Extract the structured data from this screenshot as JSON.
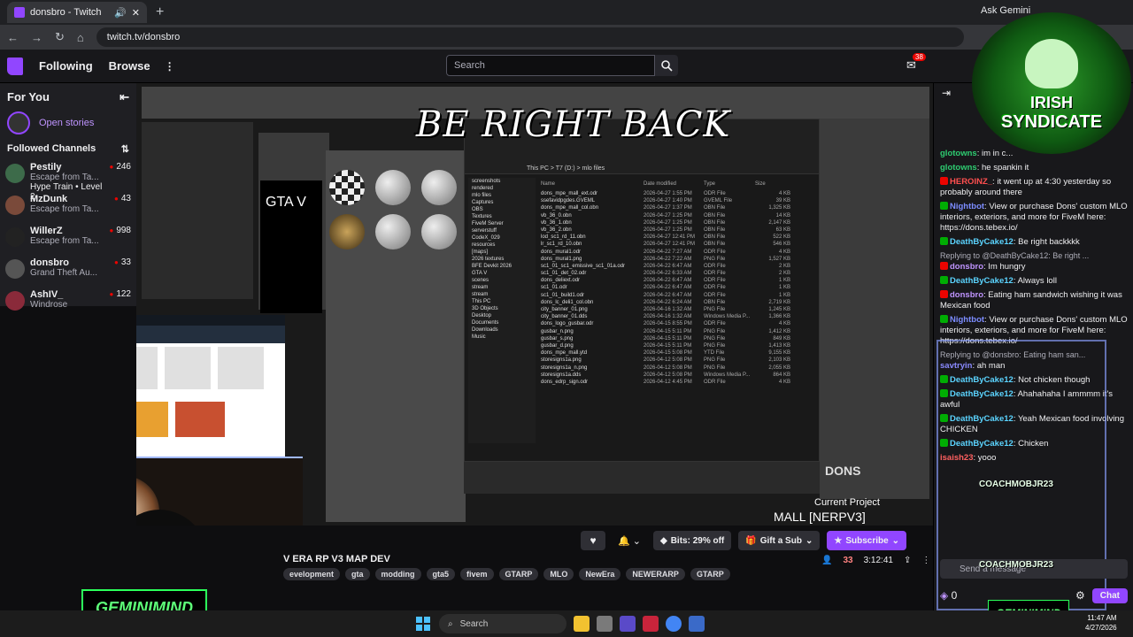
{
  "browser": {
    "tab_title": "donsbro - Twitch",
    "new_tab": "+",
    "ask_gemini": "Ask Gemini",
    "url": "twitch.tv/donsbro"
  },
  "topnav": {
    "following": "Following",
    "browse": "Browse",
    "more": "⋮",
    "search_placeholder": "Search",
    "notifications_count": "38"
  },
  "sidebar": {
    "for_you": "For You",
    "open_stories": "Open stories",
    "followed_channels": "Followed Channels",
    "channels": [
      {
        "name": "Pestily",
        "game": "Escape from Ta...",
        "viewers": "246",
        "extra": "Hype Train • Level 2",
        "color": "#3d6b4a"
      },
      {
        "name": "MzDunk",
        "game": "Escape from Ta...",
        "viewers": "43",
        "extra": "",
        "color": "#7a4a3a"
      },
      {
        "name": "WillerZ",
        "game": "Escape from Ta...",
        "viewers": "998",
        "extra": "",
        "color": "#222222"
      },
      {
        "name": "donsbro",
        "game": "Grand Theft Au...",
        "viewers": "33",
        "extra": "",
        "color": "#555555"
      },
      {
        "name": "AshIV_",
        "game": "Windrose",
        "viewers": "122",
        "extra": "",
        "color": "#8a2a3a"
      }
    ]
  },
  "stream": {
    "brb_text": "BE RIGHT BACK",
    "gta_text": "GTA V",
    "current_project_label": "Current Project",
    "current_project": "MALL [NERPV3]",
    "dons_logo": "DONS",
    "explorer_path": "This PC > T7 (D:) > mlo files",
    "explorer_columns": [
      "Name",
      "Date modified",
      "Type",
      "Size"
    ],
    "explorer_nav": [
      "screenshots",
      "rendered",
      "mlo files",
      "Captures",
      "OBS",
      "Textures",
      "FiveM Server",
      "serverstuff",
      "CodeX_029",
      "resources",
      "[maps]",
      "2026 textures",
      "BFE Devkit 2026",
      "GTA V",
      "scenes",
      "stream",
      "stream",
      "This PC",
      "3D Objects",
      "Desktop",
      "Documents",
      "Downloads",
      "Music"
    ],
    "explorer_files": [
      {
        "name": "dons_mpe_mall_ext.odr",
        "date": "2026-04-27 1:55 PM",
        "type": "ODR File",
        "size": "4 KB"
      },
      {
        "name": "ssefavidpgdes.GVEML",
        "date": "2026-04-27 1:40 PM",
        "type": "GVEML File",
        "size": "39 KB"
      },
      {
        "name": "dons_mpe_mall_col.obn",
        "date": "2026-04-27 1:37 PM",
        "type": "OBN File",
        "size": "1,325 KB"
      },
      {
        "name": "vb_36_0.obn",
        "date": "2026-04-27 1:25 PM",
        "type": "OBN File",
        "size": "14 KB"
      },
      {
        "name": "vb_36_1.obn",
        "date": "2026-04-27 1:25 PM",
        "type": "OBN File",
        "size": "2,147 KB"
      },
      {
        "name": "vb_36_2.obn",
        "date": "2026-04-27 1:25 PM",
        "type": "OBN File",
        "size": "63 KB"
      },
      {
        "name": "lod_sc1_rd_11.obn",
        "date": "2026-04-27 12:41 PM",
        "type": "OBN File",
        "size": "522 KB"
      },
      {
        "name": "lr_sc1_rd_10.obn",
        "date": "2026-04-27 12:41 PM",
        "type": "OBN File",
        "size": "546 KB"
      },
      {
        "name": "dons_mural1.odr",
        "date": "2026-04-22 7:27 AM",
        "type": "ODR File",
        "size": "4 KB"
      },
      {
        "name": "dons_mural1.png",
        "date": "2026-04-22 7:22 AM",
        "type": "PNG File",
        "size": "1,527 KB"
      },
      {
        "name": "sc1_01_sc1_emissive_sc1_01a.odr",
        "date": "2026-04-22 6:47 AM",
        "type": "ODR File",
        "size": "2 KB"
      },
      {
        "name": "sc1_01_det_02.odr",
        "date": "2026-04-22 6:33 AM",
        "type": "ODR File",
        "size": "2 KB"
      },
      {
        "name": "dons_deliext.odr",
        "date": "2026-04-22 6:47 AM",
        "type": "ODR File",
        "size": "1 KB"
      },
      {
        "name": "sc1_01.odr",
        "date": "2026-04-22 6:47 AM",
        "type": "ODR File",
        "size": "1 KB"
      },
      {
        "name": "sc1_01_build1.odr",
        "date": "2026-04-22 6:47 AM",
        "type": "ODR File",
        "size": "1 KB"
      },
      {
        "name": "dons_lc_deli1_col.obn",
        "date": "2026-04-22 6:24 AM",
        "type": "OBN File",
        "size": "2,719 KB"
      },
      {
        "name": "city_banner_01.png",
        "date": "2026-04-16 1:32 AM",
        "type": "PNG File",
        "size": "1,245 KB"
      },
      {
        "name": "city_banner_01.dds",
        "date": "2026-04-16 1:32 AM",
        "type": "Windows Media P...",
        "size": "1,366 KB"
      },
      {
        "name": "dons_logo_gusbar.odr",
        "date": "2026-04-15 8:55 PM",
        "type": "ODR File",
        "size": "4 KB"
      },
      {
        "name": "gusbar_n.png",
        "date": "2026-04-15 5:11 PM",
        "type": "PNG File",
        "size": "1,412 KB"
      },
      {
        "name": "gusbar_s.png",
        "date": "2026-04-15 5:11 PM",
        "type": "PNG File",
        "size": "849 KB"
      },
      {
        "name": "gusbar_d.png",
        "date": "2026-04-15 5:11 PM",
        "type": "PNG File",
        "size": "1,413 KB"
      },
      {
        "name": "dons_mpe_mall.ytd",
        "date": "2026-04-15 5:08 PM",
        "type": "YTD File",
        "size": "9,155 KB"
      },
      {
        "name": "storesigns1a.png",
        "date": "2026-04-12 5:08 PM",
        "type": "PNG File",
        "size": "2,103 KB"
      },
      {
        "name": "storesigns1a_n.png",
        "date": "2026-04-12 5:08 PM",
        "type": "PNG File",
        "size": "2,055 KB"
      },
      {
        "name": "storesigns1a.dds",
        "date": "2026-04-12 5:08 PM",
        "type": "Windows Media P...",
        "size": "864 KB"
      },
      {
        "name": "dons_edrp_sign.odr",
        "date": "2026-04-12 4:45 PM",
        "type": "ODR File",
        "size": "4 KB"
      }
    ]
  },
  "stream_info": {
    "title": "V ERA RP V3 MAP DEV",
    "tags": [
      "evelopment",
      "gta",
      "modding",
      "gta5",
      "fivem",
      "GTARP",
      "MLO",
      "NewEra",
      "NEWERARP",
      "GTARP"
    ],
    "bits": "Bits: 29% off",
    "gift_sub": "Gift a Sub",
    "subscribe": "Subscribe",
    "viewers": "33",
    "uptime": "3:12:41",
    "gemini_logo": "GEMINIMIND"
  },
  "chat": {
    "irish_line1": "IRISH",
    "irish_line2": "SYNDICATE",
    "messages": [
      {
        "kind": "msg",
        "user": "glotowns",
        "user_color": "#2ecc71",
        "text": "im in c...",
        "badge": ""
      },
      {
        "kind": "msg",
        "user": "glotowns",
        "user_color": "#2ecc71",
        "text": "he spankin it",
        "badge": ""
      },
      {
        "kind": "msg",
        "user": "HEROINZ_",
        "user_color": "#ff4f4f",
        "text": "it went up at 4:30 yesterday so probably around there",
        "badge": "#eb0400"
      },
      {
        "kind": "msg",
        "user": "Nightbot",
        "user_color": "#7c8cff",
        "text": "View or purchase Dons' custom MLO interiors, exteriors, and more for FiveM here: https://dons.tebex.io/",
        "badge": "#00ad03"
      },
      {
        "kind": "msg",
        "user": "DeathByCake12",
        "user_color": "#5bd4ff",
        "text": "Be right backkkk",
        "badge": "#00ad03"
      },
      {
        "kind": "reply",
        "text": "Replying to @DeathByCake12: Be right ..."
      },
      {
        "kind": "msg",
        "user": "donsbro",
        "user_color": "#bf94ff",
        "text": "Im hungry",
        "badge": "#eb0400"
      },
      {
        "kind": "msg",
        "user": "DeathByCake12",
        "user_color": "#5bd4ff",
        "text": "Always loll",
        "badge": "#00ad03"
      },
      {
        "kind": "msg",
        "user": "donsbro",
        "user_color": "#bf94ff",
        "text": "Eating ham sandwich wishing it was Mexican food",
        "badge": "#eb0400"
      },
      {
        "kind": "msg",
        "user": "Nightbot",
        "user_color": "#7c8cff",
        "text": "View or purchase Dons' custom MLO interiors, exteriors, and more for FiveM here: https://dons.tebex.io/",
        "badge": "#00ad03"
      },
      {
        "kind": "reply",
        "text": "Replying to @donsbro: Eating ham san..."
      },
      {
        "kind": "msg",
        "user": "savtryin",
        "user_color": "#8a8aff",
        "text": "ah man",
        "badge": ""
      },
      {
        "kind": "msg",
        "user": "DeathByCake12",
        "user_color": "#5bd4ff",
        "text": "Not chicken though",
        "badge": "#00ad03"
      },
      {
        "kind": "msg",
        "user": "DeathByCake12",
        "user_color": "#5bd4ff",
        "text": "Ahahahaha I ammmm it's awful",
        "badge": "#00ad03"
      },
      {
        "kind": "msg",
        "user": "DeathByCake12",
        "user_color": "#5bd4ff",
        "text": "Yeah Mexican food involving CHICKEN",
        "badge": "#00ad03"
      },
      {
        "kind": "msg",
        "user": "DeathByCake12",
        "user_color": "#5bd4ff",
        "text": "Chicken",
        "badge": "#00ad03"
      },
      {
        "kind": "msg",
        "user": "isaish23",
        "user_color": "#ff6060",
        "text": "yooo",
        "badge": ""
      }
    ],
    "coach_tag": "COACHMOBJR23",
    "input_placeholder": "Send a message",
    "points": "0",
    "chat_button": "Chat"
  },
  "taskbar": {
    "search": "Search",
    "time": "11:47 AM",
    "date": "4/27/2026"
  }
}
